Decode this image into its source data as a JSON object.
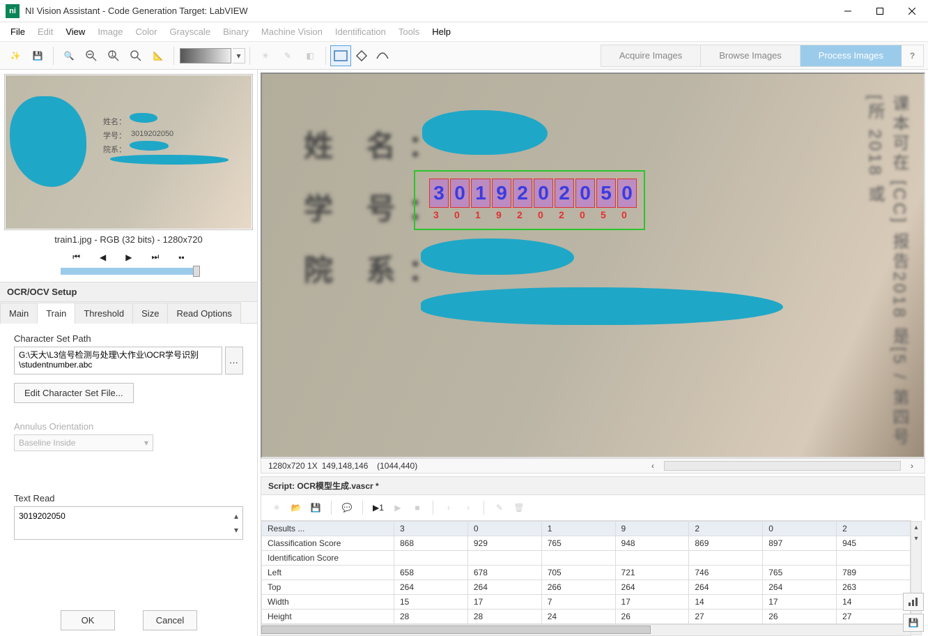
{
  "window": {
    "title": "NI Vision Assistant - Code Generation Target: LabVIEW"
  },
  "menu": {
    "file": "File",
    "edit": "Edit",
    "view": "View",
    "image": "Image",
    "color": "Color",
    "gray": "Grayscale",
    "binary": "Binary",
    "mv": "Machine Vision",
    "ident": "Identification",
    "tools": "Tools",
    "help": "Help"
  },
  "modes": {
    "acquire": "Acquire Images",
    "browse": "Browse Images",
    "process": "Process Images"
  },
  "thumb": {
    "label": "train1.jpg - RGB (32 bits) - 1280x720",
    "name_lbl": "姓名：",
    "id_lbl": "学号：",
    "id_val": "3019202050",
    "dept_lbl": "院系："
  },
  "ocr": {
    "header": "OCR/OCV Setup",
    "tabs": {
      "main": "Main",
      "train": "Train",
      "threshold": "Threshold",
      "size": "Size",
      "read": "Read Options"
    },
    "path_label": "Character Set Path",
    "path_value": "G:\\天大\\L3信号检测与处理\\大作业\\OCR学号识别\\studentnumber.abc",
    "edit_btn": "Edit Character Set File...",
    "annulus_label": "Annulus Orientation",
    "annulus_value": "Baseline Inside",
    "textread_label": "Text Read",
    "textread_value": "3019202050",
    "ok": "OK",
    "cancel": "Cancel",
    "browse": "..."
  },
  "viewer": {
    "name": "姓 名：",
    "id": "学 号：",
    "dept": "院 系：",
    "digits": [
      "3",
      "0",
      "1",
      "9",
      "2",
      "0",
      "2",
      "0",
      "5",
      "0"
    ],
    "side": "课本可在 [CC] 报告2018  是[5 / 第四号 [所 2018 或"
  },
  "status": {
    "dims": "1280x720 1X",
    "rgb": "149,148,146",
    "coord": "(1044,440)"
  },
  "script": {
    "header": "Script: OCR模型生成.vascr *"
  },
  "results": {
    "col0": "Results ...",
    "headers": [
      "3",
      "0",
      "1",
      "9",
      "2",
      "0",
      "2"
    ],
    "rows": [
      {
        "label": "Classification Score",
        "vals": [
          "868",
          "929",
          "765",
          "948",
          "869",
          "897",
          "945"
        ]
      },
      {
        "label": "Identification Score",
        "vals": [
          "",
          "",
          "",
          "",
          "",
          "",
          ""
        ]
      },
      {
        "label": "Left",
        "vals": [
          "658",
          "678",
          "705",
          "721",
          "746",
          "765",
          "789"
        ]
      },
      {
        "label": "Top",
        "vals": [
          "264",
          "264",
          "266",
          "264",
          "264",
          "264",
          "263"
        ]
      },
      {
        "label": "Width",
        "vals": [
          "15",
          "17",
          "7",
          "17",
          "14",
          "17",
          "14"
        ]
      },
      {
        "label": "Height",
        "vals": [
          "28",
          "28",
          "24",
          "26",
          "27",
          "26",
          "27"
        ]
      }
    ]
  }
}
